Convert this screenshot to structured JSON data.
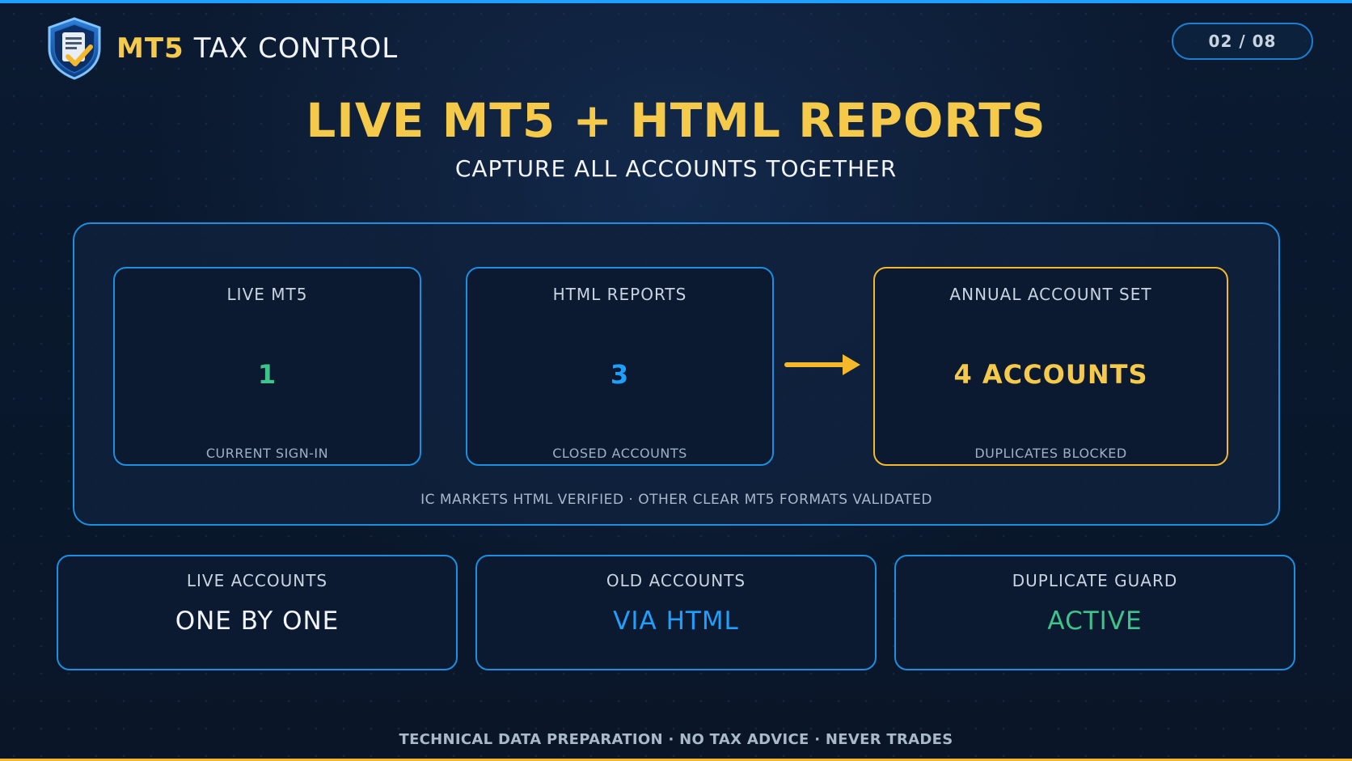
{
  "header": {
    "brand_accent": "MT5",
    "brand_main": "TAX CONTROL",
    "logo_icon": "shield-document-check-icon",
    "page_indicator": "02 / 08"
  },
  "title": "LIVE MT5 + HTML REPORTS",
  "subtitle": "CAPTURE ALL ACCOUNTS TOGETHER",
  "main_panel": {
    "cards": [
      {
        "label": "LIVE MT5",
        "value": "1",
        "footer": "CURRENT SIGN-IN",
        "color": "#3cc48a"
      },
      {
        "label": "HTML REPORTS",
        "value": "3",
        "footer": "CLOSED ACCOUNTS",
        "color": "#1ea0ff"
      },
      {
        "label": "ANNUAL ACCOUNT SET",
        "value": "4 ACCOUNTS",
        "footer": "DUPLICATES BLOCKED",
        "color": "#f5c94a"
      }
    ],
    "arrow_icon": "arrow-right-icon",
    "note": "IC MARKETS HTML VERIFIED · OTHER CLEAR MT5 FORMATS VALIDATED"
  },
  "info_cards": [
    {
      "label": "LIVE ACCOUNTS",
      "value": "ONE BY ONE",
      "color": "#f1f4f8"
    },
    {
      "label": "OLD ACCOUNTS",
      "value": "VIA HTML",
      "color": "#1ea0ff"
    },
    {
      "label": "DUPLICATE GUARD",
      "value": "ACTIVE",
      "color": "#3cc48a"
    }
  ],
  "footer": "TECHNICAL DATA PREPARATION · NO TAX ADVICE · NEVER TRADES",
  "colors": {
    "accent_blue": "#1ea0ff",
    "accent_gold": "#f5b82a",
    "background": "#0a1628"
  }
}
